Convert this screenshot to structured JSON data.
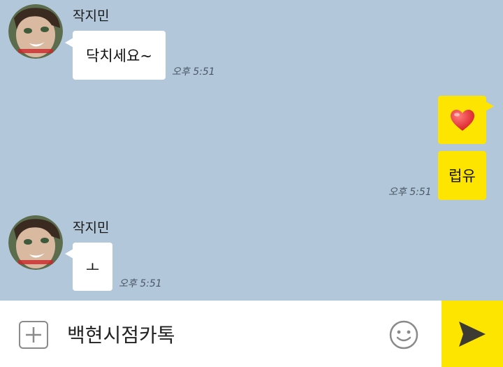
{
  "chat": {
    "messages": [
      {
        "sender": "작지민",
        "text": "닥치세요~",
        "time": "오후 5:51"
      },
      {
        "text": "❤",
        "time": ""
      },
      {
        "text": "럽유",
        "time": "오후 5:51"
      },
      {
        "sender": "작지민",
        "text": "ㅗ",
        "time": "오후 5:51"
      }
    ]
  },
  "composer": {
    "input_value": "백현시점카톡"
  },
  "icons": {
    "attach": "plus-icon",
    "emoji": "smiley-icon",
    "send": "send-arrow-icon"
  },
  "colors": {
    "background": "#b2c7da",
    "my_bubble": "#fee500",
    "their_bubble": "#ffffff",
    "send_button": "#fee500",
    "heart": "#e8202a"
  }
}
